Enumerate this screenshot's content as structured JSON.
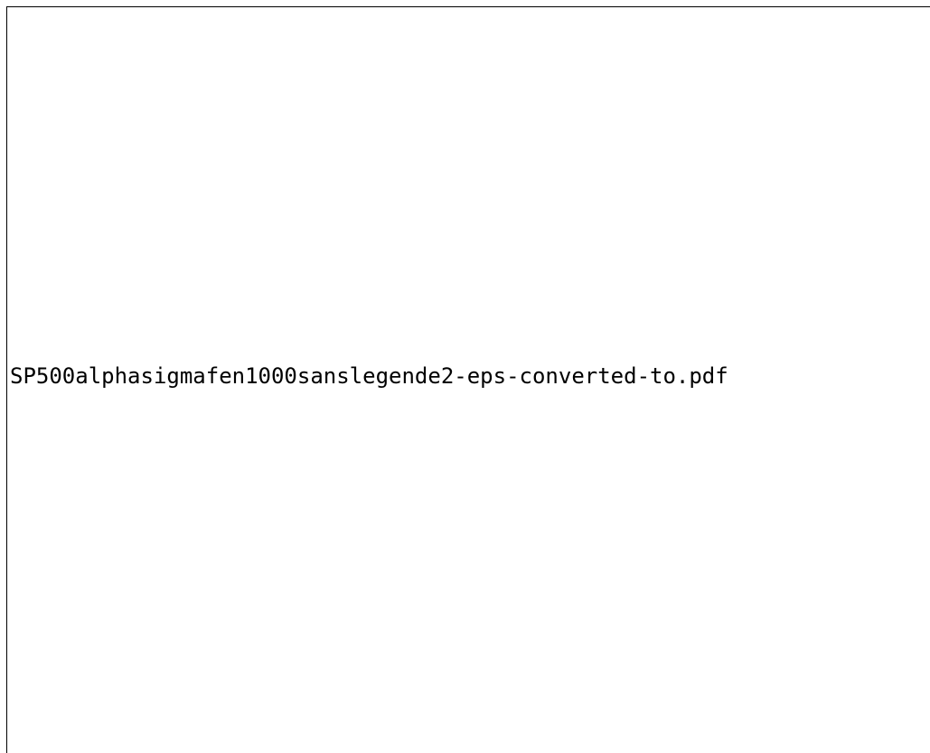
{
  "figure": {
    "missing_image_label": "SP500alphasigmafen1000sanslegende2-eps-converted-to.pdf",
    "border_color": "#000000",
    "background_color": "#ffffff"
  }
}
